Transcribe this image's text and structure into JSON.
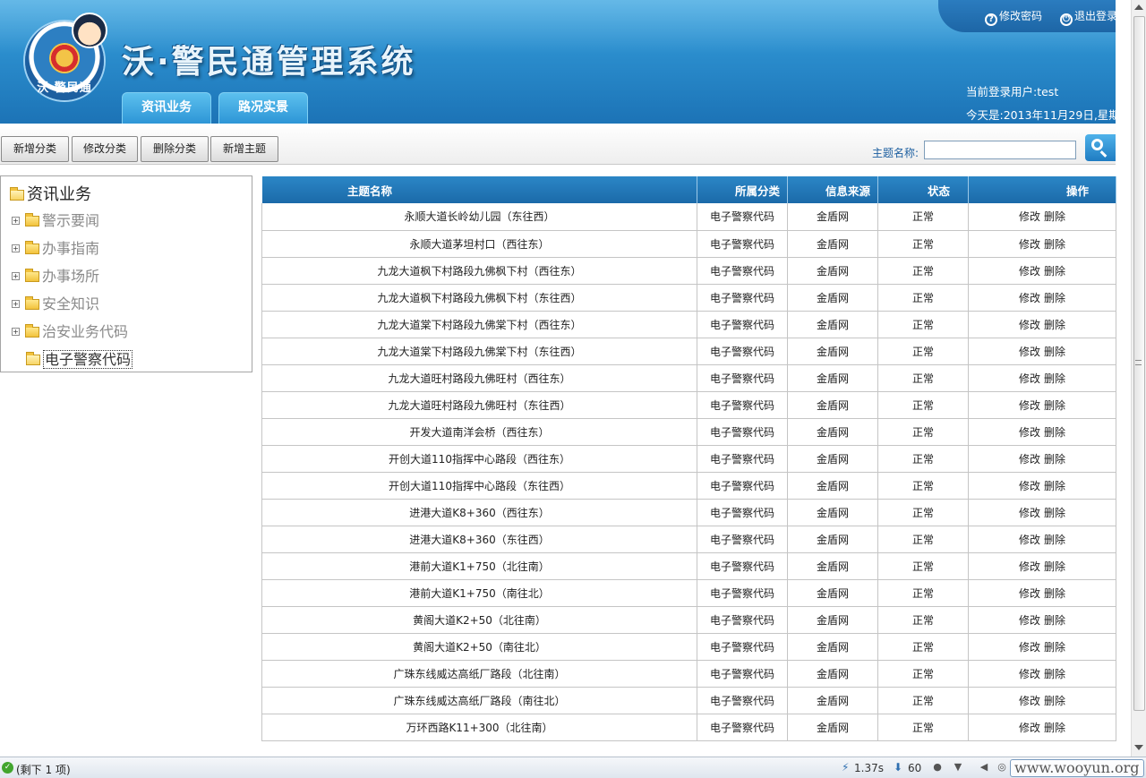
{
  "header": {
    "logo_text": "沃·警民通",
    "app_title": "沃·警民通管理系统",
    "change_password": "修改密码",
    "logout": "退出登录",
    "current_user": "当前登录用户:test",
    "today": "今天是:2013年11月29日,星期",
    "tabs": [
      "资讯业务",
      "路况实景"
    ]
  },
  "toolbar": {
    "add_category": "新增分类",
    "edit_category": "修改分类",
    "delete_category": "删除分类",
    "add_topic": "新增主题",
    "search_label": "主题名称:",
    "search_value": ""
  },
  "tree": {
    "root": "资讯业务",
    "nodes": [
      "警示要闻",
      "办事指南",
      "办事场所",
      "安全知识",
      "治安业务代码",
      "电子警察代码"
    ]
  },
  "table": {
    "headers": [
      "主题名称",
      "所属分类",
      "信息来源",
      "状态",
      "操作"
    ],
    "edit_label": "修改",
    "delete_label": "删除",
    "rows": [
      [
        "永顺大道长岭幼儿园（东往西）",
        "电子警察代码",
        "金盾网",
        "正常"
      ],
      [
        "永顺大道茅坦村口（西往东）",
        "电子警察代码",
        "金盾网",
        "正常"
      ],
      [
        "九龙大道枫下村路段九佛枫下村（西往东）",
        "电子警察代码",
        "金盾网",
        "正常"
      ],
      [
        "九龙大道枫下村路段九佛枫下村（东往西）",
        "电子警察代码",
        "金盾网",
        "正常"
      ],
      [
        "九龙大道棠下村路段九佛棠下村（西往东）",
        "电子警察代码",
        "金盾网",
        "正常"
      ],
      [
        "九龙大道棠下村路段九佛棠下村（东往西）",
        "电子警察代码",
        "金盾网",
        "正常"
      ],
      [
        "九龙大道旺村路段九佛旺村（西往东）",
        "电子警察代码",
        "金盾网",
        "正常"
      ],
      [
        "九龙大道旺村路段九佛旺村（东往西）",
        "电子警察代码",
        "金盾网",
        "正常"
      ],
      [
        "开发大道南洋会桥（西往东）",
        "电子警察代码",
        "金盾网",
        "正常"
      ],
      [
        "开创大道110指挥中心路段（西往东）",
        "电子警察代码",
        "金盾网",
        "正常"
      ],
      [
        "开创大道110指挥中心路段（东往西）",
        "电子警察代码",
        "金盾网",
        "正常"
      ],
      [
        "进港大道K8+360（西往东）",
        "电子警察代码",
        "金盾网",
        "正常"
      ],
      [
        "进港大道K8+360（东往西）",
        "电子警察代码",
        "金盾网",
        "正常"
      ],
      [
        "港前大道K1+750（北往南）",
        "电子警察代码",
        "金盾网",
        "正常"
      ],
      [
        "港前大道K1+750（南往北）",
        "电子警察代码",
        "金盾网",
        "正常"
      ],
      [
        "黄阁大道K2+50（北往南）",
        "电子警察代码",
        "金盾网",
        "正常"
      ],
      [
        "黄阁大道K2+50（南往北）",
        "电子警察代码",
        "金盾网",
        "正常"
      ],
      [
        "广珠东线威达高纸厂路段（北往南）",
        "电子警察代码",
        "金盾网",
        "正常"
      ],
      [
        "广珠东线威达高纸厂路段（南往北）",
        "电子警察代码",
        "金盾网",
        "正常"
      ],
      [
        "万环西路K11+300（北往南）",
        "电子警察代码",
        "金盾网",
        "正常"
      ]
    ]
  },
  "status_bar": {
    "text": "(剩下 1 项)",
    "speed": "1.37s",
    "count": "60",
    "watermark": "www.wooyun.org"
  }
}
